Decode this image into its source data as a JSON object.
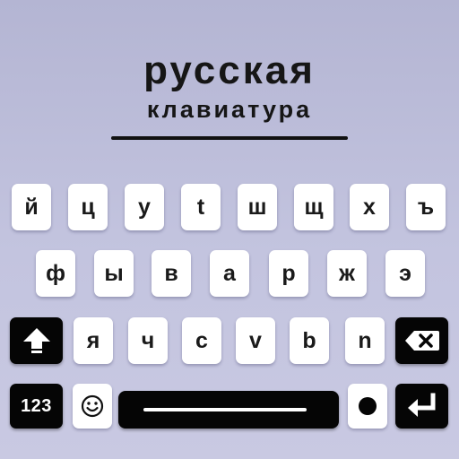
{
  "header": {
    "title": "русская",
    "subtitle": "клавиатура"
  },
  "keyboard": {
    "row1": [
      "й",
      "ц",
      "у",
      "t",
      "ш",
      "щ",
      "х",
      "ъ"
    ],
    "row2": [
      "ф",
      "ы",
      "в",
      "а",
      "р",
      "ж",
      "э"
    ],
    "row3": [
      "я",
      "ч",
      "с",
      "v",
      "b",
      "n"
    ],
    "numbers_label": "123",
    "icons": {
      "shift": "shift-arrow-icon",
      "backspace": "backspace-icon",
      "emoji": "smiley-icon",
      "period": "dot-icon",
      "enter": "enter-return-icon"
    }
  },
  "colors": {
    "background_top": "#b4b5d3",
    "background_bottom": "#c9c9e2",
    "key_light": "#ffffff",
    "key_dark": "#050505"
  }
}
